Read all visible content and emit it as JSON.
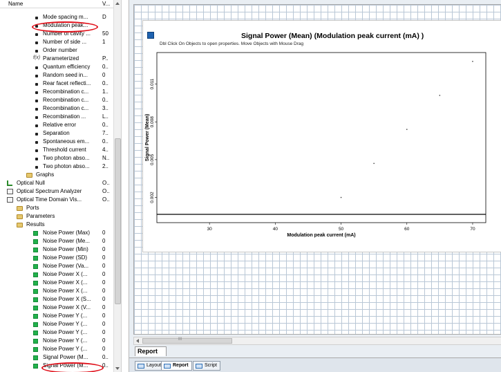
{
  "tree": {
    "header_name": "Name",
    "header_value": "V...",
    "rows": [
      {
        "label": "Mode spacing m...",
        "value": "D",
        "indent": 62,
        "icon": "dot"
      },
      {
        "label": "Modulation peak...",
        "value": "",
        "indent": 62,
        "icon": "dot",
        "selected": true
      },
      {
        "label": "Number of cavity ...",
        "value": "50",
        "indent": 62,
        "icon": "dot"
      },
      {
        "label": "Number of side ...",
        "value": "1",
        "indent": 62,
        "icon": "dot"
      },
      {
        "label": "Order number",
        "value": "",
        "indent": 62,
        "icon": "dot"
      },
      {
        "label": "Parameterized",
        "value": "P..",
        "indent": 62,
        "icon": "fx"
      },
      {
        "label": "Quantum efficiency",
        "value": "0..",
        "indent": 62,
        "icon": "dot"
      },
      {
        "label": "Random seed in...",
        "value": "0",
        "indent": 62,
        "icon": "dot"
      },
      {
        "label": "Rear facet reflecti...",
        "value": "0..",
        "indent": 62,
        "icon": "dot"
      },
      {
        "label": "Recombination c...",
        "value": "1..",
        "indent": 62,
        "icon": "dot"
      },
      {
        "label": "Recombination c...",
        "value": "0..",
        "indent": 62,
        "icon": "dot"
      },
      {
        "label": "Recombination c...",
        "value": "3..",
        "indent": 62,
        "icon": "dot"
      },
      {
        "label": "Recombination ...",
        "value": "L..",
        "indent": 62,
        "icon": "dot"
      },
      {
        "label": "Relative error",
        "value": "0..",
        "indent": 62,
        "icon": "dot"
      },
      {
        "label": "Separation",
        "value": "7..",
        "indent": 62,
        "icon": "dot"
      },
      {
        "label": "Spontaneous em...",
        "value": "0..",
        "indent": 62,
        "icon": "dot"
      },
      {
        "label": "Threshold current",
        "value": "4..",
        "indent": 62,
        "icon": "dot"
      },
      {
        "label": "Two photon abso...",
        "value": "N..",
        "indent": 62,
        "icon": "dot"
      },
      {
        "label": "Two photon abso...",
        "value": "2..",
        "indent": 62,
        "icon": "dot"
      },
      {
        "label": "Graphs",
        "value": "",
        "indent": 52,
        "icon": "folder"
      },
      {
        "label": "Optical Null",
        "value": "O..",
        "indent": 24,
        "icon": "null"
      },
      {
        "label": "Optical Spectrum Analyzer",
        "value": "O..",
        "indent": 24,
        "icon": "dev"
      },
      {
        "label": "Optical Time Domain Vis...",
        "value": "O..",
        "indent": 24,
        "icon": "dev"
      },
      {
        "label": "Ports",
        "value": "",
        "indent": 38,
        "icon": "folder"
      },
      {
        "label": "Parameters",
        "value": "",
        "indent": 38,
        "icon": "folder"
      },
      {
        "label": "Results",
        "value": "",
        "indent": 38,
        "icon": "folder"
      },
      {
        "label": "Noise Power (Max)",
        "value": "0",
        "indent": 62,
        "icon": "green"
      },
      {
        "label": "Noise Power (Me...",
        "value": "0",
        "indent": 62,
        "icon": "green"
      },
      {
        "label": "Noise Power (Min)",
        "value": "0",
        "indent": 62,
        "icon": "green"
      },
      {
        "label": "Noise Power (SD)",
        "value": "0",
        "indent": 62,
        "icon": "green"
      },
      {
        "label": "Noise Power (Va...",
        "value": "0",
        "indent": 62,
        "icon": "green"
      },
      {
        "label": "Noise Power X (...",
        "value": "0",
        "indent": 62,
        "icon": "green"
      },
      {
        "label": "Noise Power X (...",
        "value": "0",
        "indent": 62,
        "icon": "green"
      },
      {
        "label": "Noise Power X (...",
        "value": "0",
        "indent": 62,
        "icon": "green"
      },
      {
        "label": "Noise Power X (S...",
        "value": "0",
        "indent": 62,
        "icon": "green"
      },
      {
        "label": "Noise Power X (V...",
        "value": "0",
        "indent": 62,
        "icon": "green"
      },
      {
        "label": "Noise Power Y (...",
        "value": "0",
        "indent": 62,
        "icon": "green"
      },
      {
        "label": "Noise Power Y (...",
        "value": "0",
        "indent": 62,
        "icon": "green"
      },
      {
        "label": "Noise Power Y (...",
        "value": "0",
        "indent": 62,
        "icon": "green"
      },
      {
        "label": "Noise Power Y (...",
        "value": "0",
        "indent": 62,
        "icon": "green"
      },
      {
        "label": "Noise Power Y (...",
        "value": "0",
        "indent": 62,
        "icon": "green"
      },
      {
        "label": "Signal Power (M...",
        "value": "0..",
        "indent": 62,
        "icon": "green"
      },
      {
        "label": "Signal Power (M...",
        "value": "0..",
        "indent": 62,
        "icon": "green"
      }
    ]
  },
  "report": {
    "graph_title": "Signal Power (Mean) (Modulation peak current (mA) )",
    "graph_subtitle": "Dbl Click On Objects to open properties.  Move Objects with Mouse Drag",
    "tab_label": "Report",
    "scroll_grip": "III"
  },
  "bottom_tabs": [
    {
      "label": "Layout",
      "active": false
    },
    {
      "label": "Report",
      "active": true
    },
    {
      "label": "Script",
      "active": false
    }
  ],
  "chart_data": {
    "type": "scatter",
    "title": "",
    "xlabel": "Modulation peak current (mA)",
    "ylabel": "Signal Power (Mean)",
    "xlim": [
      22,
      72
    ],
    "ylim": [
      0,
      0.0135
    ],
    "xticks": [
      30,
      40,
      50,
      60,
      70
    ],
    "yticks": [
      0.002,
      0.005,
      0.008,
      0.011
    ],
    "ytick_labels": [
      "0.002",
      "0.005",
      "0.008",
      "0.011"
    ],
    "points": [
      {
        "x": 50,
        "y": 0.002
      },
      {
        "x": 55,
        "y": 0.0047
      },
      {
        "x": 60,
        "y": 0.0074
      },
      {
        "x": 65,
        "y": 0.0101
      },
      {
        "x": 70,
        "y": 0.0128
      }
    ],
    "grid": false
  }
}
